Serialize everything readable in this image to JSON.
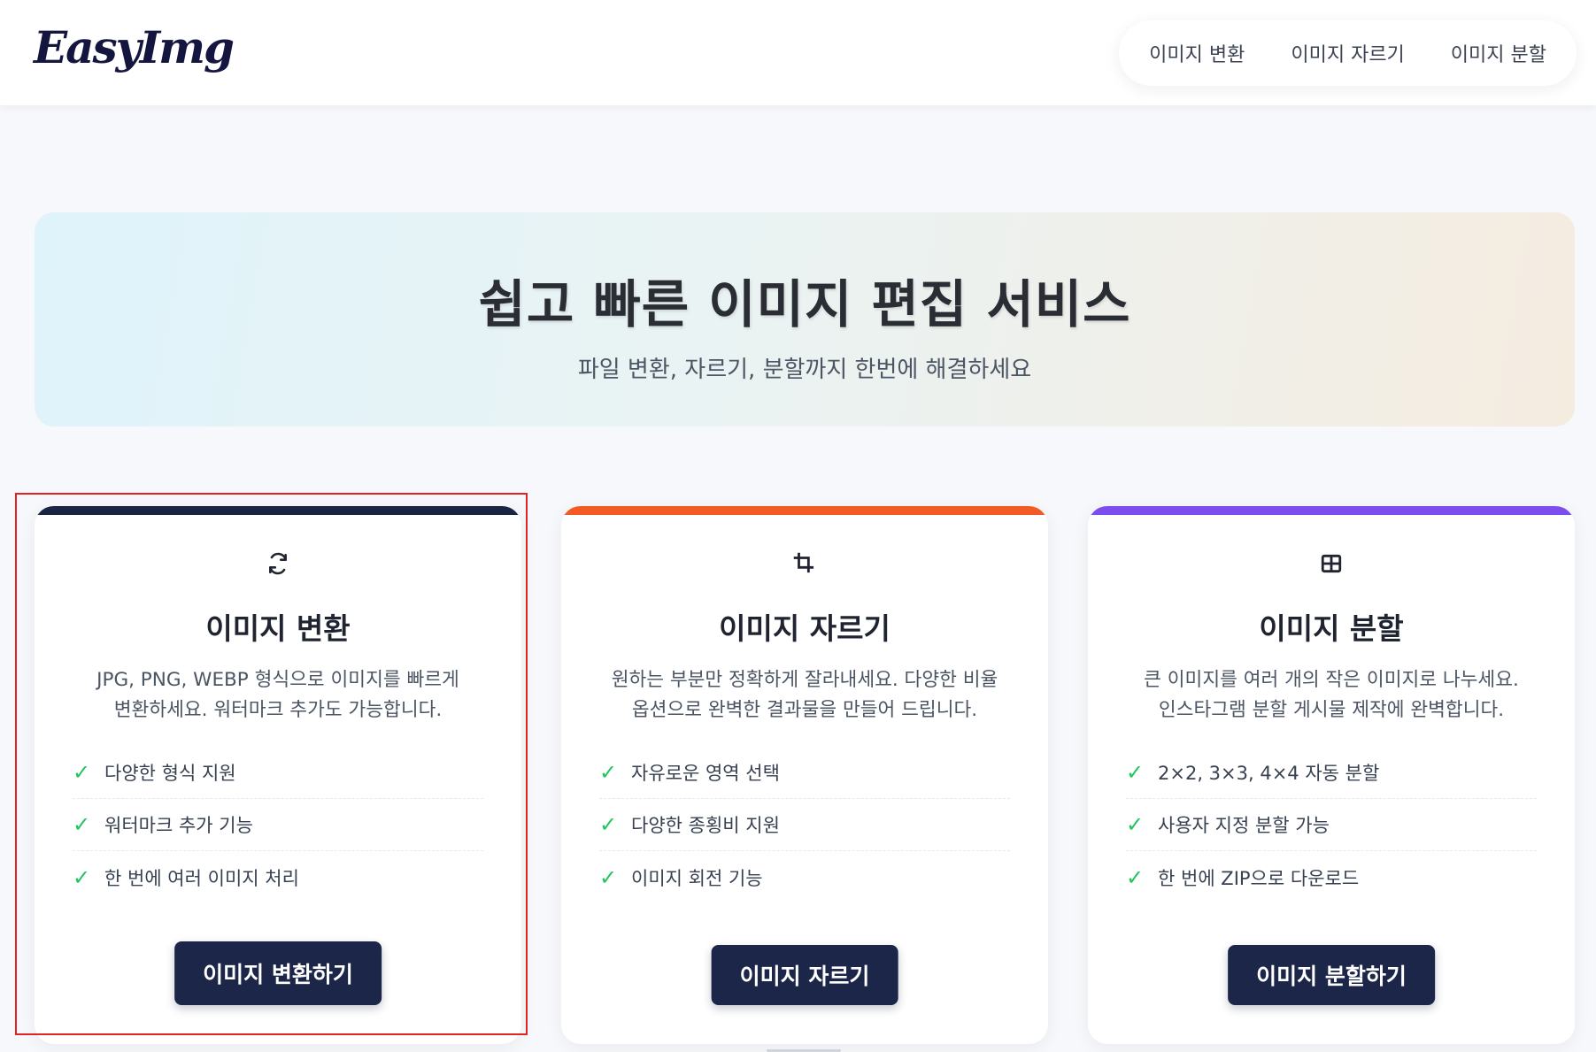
{
  "header": {
    "logo": "EasyImg",
    "nav": [
      {
        "label": "이미지 변환"
      },
      {
        "label": "이미지 자르기"
      },
      {
        "label": "이미지 분할"
      }
    ]
  },
  "hero": {
    "title": "쉽고 빠른 이미지 편집 서비스",
    "subtitle": "파일 변환, 자르기, 분할까지 한번에 해결하세요"
  },
  "cards": [
    {
      "icon": "refresh-icon",
      "accent": "#1c2444",
      "title": "이미지 변환",
      "desc_line1": "JPG, PNG, WEBP 형식으로 이미지를 빠르게",
      "desc_line2": "변환하세요. 워터마크 추가도 가능합니다.",
      "features": [
        "다양한 형식 지원",
        "워터마크 추가 기능",
        "한 번에 여러 이미지 처리"
      ],
      "button": "이미지 변환하기"
    },
    {
      "icon": "crop-icon",
      "accent": "#f35b25",
      "title": "이미지 자르기",
      "desc_line1": "원하는 부분만 정확하게 잘라내세요. 다양한 비율",
      "desc_line2": "옵션으로 완벽한 결과물을 만들어 드립니다.",
      "features": [
        "자유로운 영역 선택",
        "다양한 종횡비 지원",
        "이미지 회전 기능"
      ],
      "button": "이미지 자르기"
    },
    {
      "icon": "grid-icon",
      "accent": "#7c4ef0",
      "title": "이미지 분할",
      "desc_line1": "큰 이미지를 여러 개의 작은 이미지로 나누세요.",
      "desc_line2": "인스타그램 분할 게시물 제작에 완벽합니다.",
      "features": [
        "2×2, 3×3, 4×4 자동 분할",
        "사용자 지정 분할 가능",
        "한 번에 ZIP으로 다운로드"
      ],
      "button": "이미지 분할하기"
    }
  ],
  "check_mark": "✓",
  "colors": {
    "primary": "#1c2649",
    "check": "#22c55e",
    "highlight": "#e02424"
  }
}
